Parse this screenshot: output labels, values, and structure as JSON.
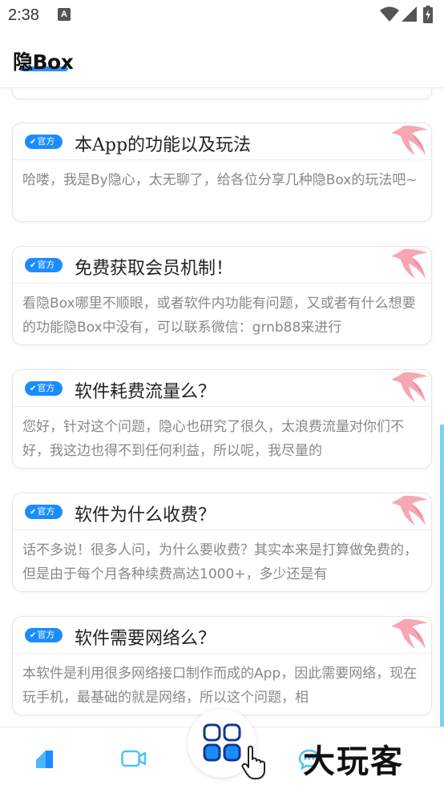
{
  "status_bar": {
    "time": "2:38",
    "notification_icon": "a-notification-icon"
  },
  "header": {
    "title": "隐Box"
  },
  "badge_label": "官方",
  "badge_check": "✔",
  "cards": [
    {
      "title": "本App的功能以及玩法",
      "excerpt": "哈喽，我是By隐心，太无聊了，给各位分享几种隐Box的玩法吧~"
    },
    {
      "title": "免费获取会员机制！",
      "excerpt": "看隐Box哪里不顺眼，或者软件内功能有问题，又或者有什么想要的功能隐Box中没有，可以联系微信：grnb88来进行"
    },
    {
      "title": "软件耗费流量么？",
      "excerpt": "您好，针对这个问题，隐心也研究了很久，太浪费流量对你们不好，我这边也得不到任何利益，所以呢，我尽量的"
    },
    {
      "title": "软件为什么收费？",
      "excerpt": "话不多说！很多人问，为什么要收费？其实本来是打算做免费的，但是由于每个月各种续费高达1000+，多少还是有"
    },
    {
      "title": "软件需要网络么？",
      "excerpt": "本软件是利用很多网络接口制作而成的App，因此需要网络，现在玩手机，最基础的就是网络，所以这个问题，相"
    }
  ],
  "bottom_nav": {
    "items": [
      "home-icon",
      "video-icon",
      "apps-grid-icon",
      "chat-icon"
    ]
  },
  "watermark": "大玩客",
  "colors": {
    "accent": "#1a8cff",
    "scrollbar": "#7fd0f7",
    "deco": "#f26a82"
  }
}
